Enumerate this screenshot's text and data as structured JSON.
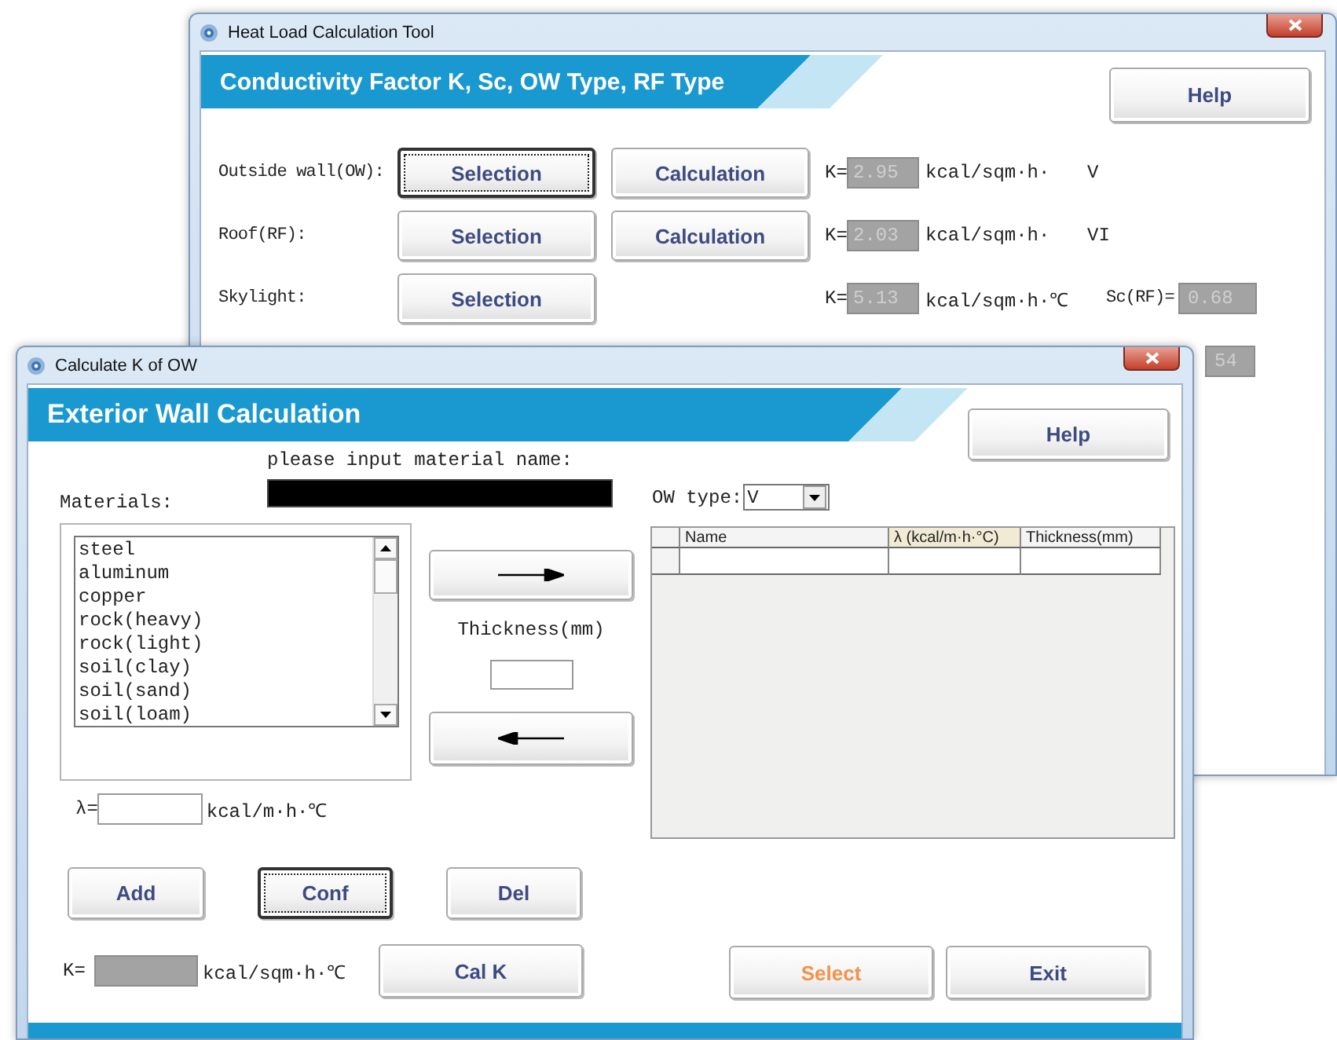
{
  "back_window": {
    "title": "Heat Load Calculation Tool",
    "header": "Conductivity Factor K, Sc, OW Type, RF Type",
    "help_button": "Help",
    "rows": [
      {
        "label": "Outside wall(OW):",
        "buttons": [
          {
            "label": "Selection",
            "focused": true
          },
          {
            "label": "Calculation",
            "focused": false
          }
        ],
        "k_label": "K=",
        "k_value": "2.95",
        "unit": "kcal/sqm·h·",
        "type_value": "V"
      },
      {
        "label": "Roof(RF):",
        "buttons": [
          {
            "label": "Selection",
            "focused": false
          },
          {
            "label": "Calculation",
            "focused": false
          }
        ],
        "k_label": "K=",
        "k_value": "2.03",
        "unit": "kcal/sqm·h·",
        "type_value": "VI"
      },
      {
        "label": "Skylight:",
        "buttons": [
          {
            "label": "Selection",
            "focused": false
          }
        ],
        "k_label": "K=",
        "k_value": "5.13",
        "unit": "kcal/sqm·h·℃",
        "extra_label": "Sc(RF)=",
        "extra_value": "0.68"
      },
      {
        "extra_value": "54"
      }
    ]
  },
  "front_window": {
    "title": "Calculate K of OW",
    "header": "Exterior Wall Calculation",
    "help_button": "Help",
    "name_prompt": "please input material name:",
    "materials_label": "Materials:",
    "materials": [
      "steel",
      "aluminum",
      "copper",
      "rock(heavy)",
      "rock(light)",
      "soil(clay)",
      "soil(sand)",
      "soil(loam)"
    ],
    "thickness_label": "Thickness(mm)",
    "lambda_label": "λ=",
    "lambda_unit": "kcal/m·h·℃",
    "action_buttons": [
      {
        "label": "Add",
        "focused": false
      },
      {
        "label": "Conf",
        "focused": true
      },
      {
        "label": "Del",
        "focused": false
      }
    ],
    "k_label": "K=",
    "k_unit": "kcal/sqm·h·℃",
    "cal_k_button": "Cal K",
    "ow_type_label": "OW type:",
    "ow_type_value": "V",
    "table": {
      "columns": [
        {
          "label": "Name",
          "highlighted": false
        },
        {
          "label": "λ (kcal/m·h·°C)",
          "highlighted": true
        },
        {
          "label": "Thickness(mm)",
          "highlighted": false
        }
      ]
    },
    "bottom_buttons": [
      {
        "label": "Select",
        "accent": true
      },
      {
        "label": "Exit",
        "accent": false
      }
    ]
  }
}
